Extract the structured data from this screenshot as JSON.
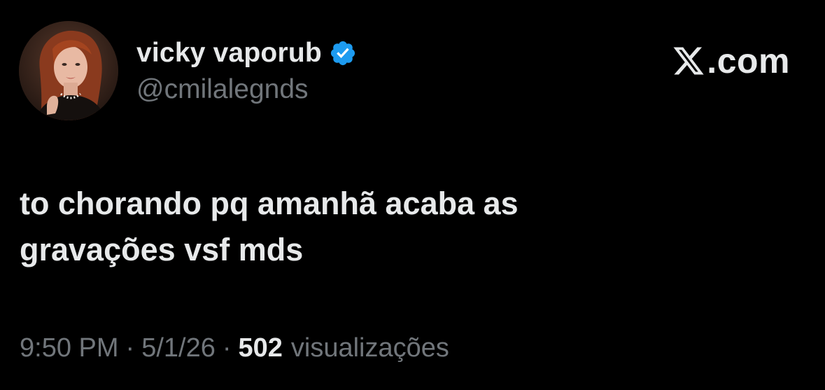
{
  "author": {
    "display_name": "vicky vaporub",
    "handle": "@cmilalegnds",
    "verified": true,
    "avatar_icon": "profile-photo"
  },
  "brand": {
    "logo_icon": "x-logo-icon",
    "text": ".com"
  },
  "tweet": {
    "text_lines": [
      "to chorando pq amanhã acaba as",
      "gravações vsf mds"
    ]
  },
  "meta": {
    "time": "9:50 PM",
    "separator": "·",
    "date": "5/1/26",
    "views_count": "502",
    "views_label": "visualizações"
  },
  "colors": {
    "background": "#000000",
    "primary_text": "#e7e9ea",
    "secondary_text": "#71767b",
    "verified_blue": "#1d9bf0"
  }
}
